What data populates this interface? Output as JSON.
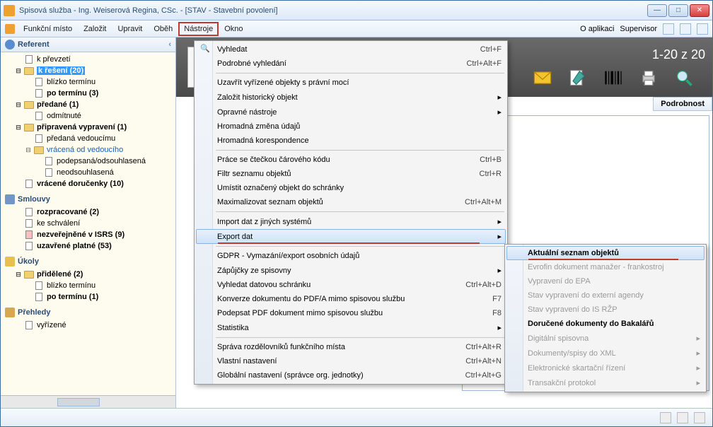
{
  "window": {
    "title": "Spisová služba - Ing. Weiserová Regina, CSc. - [STAV - Stavební povolení]"
  },
  "menubar": {
    "items": [
      "Funkční místo",
      "Založit",
      "Upravit",
      "Oběh",
      "Nástroje",
      "Okno"
    ],
    "active_index": 4,
    "right": {
      "about": "O aplikaci",
      "user": "Supervisor"
    }
  },
  "sidebar": {
    "header": "Referent",
    "tree": {
      "k_prevzeti": "k převzetí",
      "k_reseni": "k řešení (20)",
      "blizko_terminu": "blízko termínu",
      "po_terminu": "po termínu (3)",
      "predane": "předané (1)",
      "odmitnute": "odmítnuté",
      "pripravena_vypraveni": "připravená vypravení (1)",
      "predana_vedoucimu": "předaná vedoucímu",
      "vracena_od_vedouciho": "vrácená od vedoucího",
      "podepsana": "podepsaná/odsouhlasená",
      "neodsouhlasena": "neodsouhlasená",
      "vracene_dorucenky": "vrácené doručenky (10)"
    },
    "smlouvy": {
      "header": "Smlouvy",
      "rozpracovane": "rozpracované (2)",
      "ke_schvaleni": "ke schválení",
      "nezverejnene": "nezveřejněné v ISRS (9)",
      "uzavrene": "uzavřené platné (53)"
    },
    "ukoly": {
      "header": "Úkoly",
      "pridelene": "přidělené (2)",
      "blizko_terminu": "blízko termínu",
      "po_terminu": "po termínu (1)"
    },
    "prehledy": {
      "header": "Přehledy",
      "vyrizene": "vyřízené"
    }
  },
  "main": {
    "count": "1-20 z 20",
    "column_header": "Podrobnost"
  },
  "menu_tools": {
    "items": [
      {
        "label": "Vyhledat",
        "shortcut": "Ctrl+F",
        "icon": "search"
      },
      {
        "label": "Podrobné vyhledání",
        "shortcut": "Ctrl+Alt+F"
      },
      {
        "sep": true
      },
      {
        "label": "Uzavřít vyřízené objekty s právní mocí"
      },
      {
        "label": "Založit historický objekt",
        "submenu": true
      },
      {
        "label": "Opravné nástroje",
        "submenu": true
      },
      {
        "label": "Hromadná změna údajů"
      },
      {
        "label": "Hromadná korespondence"
      },
      {
        "sep": true
      },
      {
        "label": "Práce se čtečkou čárového kódu",
        "shortcut": "Ctrl+B"
      },
      {
        "label": "Filtr seznamu objektů",
        "shortcut": "Ctrl+R"
      },
      {
        "label": "Umístit označený objekt do schránky"
      },
      {
        "label": "Maximalizovat seznam objektů",
        "shortcut": "Ctrl+Alt+M"
      },
      {
        "sep": true
      },
      {
        "label": "Import dat z jiných systémů",
        "submenu": true
      },
      {
        "label": "Export dat",
        "submenu": true,
        "hover": true,
        "underline": true
      },
      {
        "sep": true
      },
      {
        "label": "GDPR - Vymazání/export osobních údajů"
      },
      {
        "label": "Zápůjčky ze spisovny",
        "submenu": true
      },
      {
        "label": "Vyhledat datovou schránku",
        "shortcut": "Ctrl+Alt+D"
      },
      {
        "label": "Konverze dokumentu do PDF/A mimo spisovou službu",
        "shortcut": "F7"
      },
      {
        "label": "Podepsat PDF dokument mimo spisovou službu",
        "shortcut": "F8"
      },
      {
        "label": "Statistika",
        "submenu": true
      },
      {
        "sep": true
      },
      {
        "label": "Správa rozdělovníků funkčního místa",
        "shortcut": "Ctrl+Alt+R"
      },
      {
        "label": "Vlastní nastavení",
        "shortcut": "Ctrl+Alt+N"
      },
      {
        "label": "Globální nastavení (správce org. jednotky)",
        "shortcut": "Ctrl+Alt+G"
      }
    ]
  },
  "submenu_export": {
    "items": [
      {
        "label": "Aktuální seznam objektů",
        "bold": true,
        "hover": true,
        "underline": true
      },
      {
        "label": "Evrofin dokument manažer - frankostroj",
        "disabled": true
      },
      {
        "label": "Vypravení do EPA",
        "disabled": true
      },
      {
        "label": "Stav vypravení do externí agendy",
        "disabled": true
      },
      {
        "label": "Stav vypravení do IS RŽP",
        "disabled": true
      },
      {
        "label": "Doručené dokumenty do Bakalářů",
        "bold": true
      },
      {
        "label": "Digitální spisovna",
        "disabled": true,
        "submenu": true
      },
      {
        "label": "Dokumenty/spisy do XML",
        "disabled": true,
        "submenu": true
      },
      {
        "label": "Elektronické skartační řízení",
        "disabled": true,
        "submenu": true
      },
      {
        "label": "Transakční protokol",
        "disabled": true,
        "submenu": true
      }
    ]
  }
}
